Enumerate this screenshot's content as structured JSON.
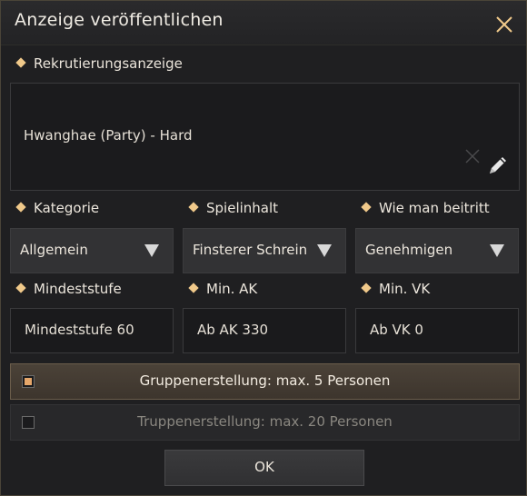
{
  "dialog": {
    "title": "Anzeige veröffentlichen"
  },
  "ad": {
    "label": "Rekrutierungsanzeige",
    "text": "Hwanghae (Party) - Hard"
  },
  "filters": {
    "category": {
      "label": "Kategorie",
      "value": "Allgemein"
    },
    "content": {
      "label": "Spielinhalt",
      "value": "Finsterer Schrein"
    },
    "join": {
      "label": "Wie man beitritt",
      "value": "Genehmigen"
    }
  },
  "requirements": {
    "min_level": {
      "label": "Mindeststufe",
      "value": "Mindeststufe 60"
    },
    "min_ap": {
      "label": "Min. AK",
      "value": "Ab AK 330"
    },
    "min_dp": {
      "label": "Min. VK",
      "value": "Ab VK 0"
    }
  },
  "options": {
    "group": {
      "label": "Gruppenerstellung: max. 5 Personen",
      "selected": true
    },
    "troop": {
      "label": "Truppenerstellung: max. 20 Personen",
      "selected": false
    }
  },
  "ok_label": "OK",
  "colors": {
    "accent_diamond": "#f0c98a",
    "selected_checkbox": "#e5a66a"
  }
}
